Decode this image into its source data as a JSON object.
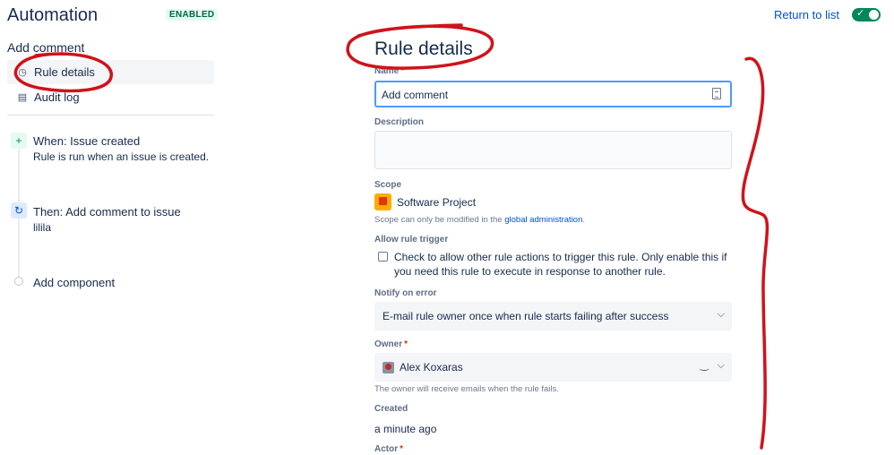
{
  "header": {
    "title": "Automation",
    "badge": "ENABLED",
    "return_label": "Return to list",
    "toggle_check": "✓"
  },
  "sidebar": {
    "section_title": "Add comment",
    "items": [
      {
        "label": "Rule details",
        "icon": "clock-icon",
        "glyph": "◷"
      },
      {
        "label": "Audit log",
        "icon": "document-icon",
        "glyph": "▤"
      }
    ]
  },
  "timeline": {
    "when": {
      "glyph": "+",
      "title": "When: Issue created",
      "subtitle": "Rule is run when an issue is created."
    },
    "then": {
      "glyph": "↻",
      "title": "Then: Add comment to issue",
      "subtitle": "lilila"
    },
    "add_component": "Add component"
  },
  "main": {
    "title": "Rule details",
    "name": {
      "label": "Name",
      "value": "Add comment"
    },
    "description": {
      "label": "Description",
      "value": ""
    },
    "scope": {
      "label": "Scope",
      "project": "Software Project",
      "help_prefix": "Scope can only be modified in the ",
      "help_link": "global administration",
      "help_suffix": "."
    },
    "allow_trigger": {
      "label": "Allow rule trigger",
      "text": "Check to allow other rule actions to trigger this rule. Only enable this if you need this rule to execute in response to another rule.",
      "checked": false
    },
    "notify": {
      "label": "Notify on error",
      "value": "E-mail rule owner once when rule starts failing after success"
    },
    "owner": {
      "label": "Owner",
      "value": "Alex Koxaras",
      "help": "The owner will receive emails when the rule fails."
    },
    "created": {
      "label": "Created",
      "value": "a minute ago"
    },
    "actor": {
      "label": "Actor"
    }
  },
  "colors": {
    "annotation": "#d0121a",
    "primary": "#0052cc",
    "success": "#00875a"
  }
}
